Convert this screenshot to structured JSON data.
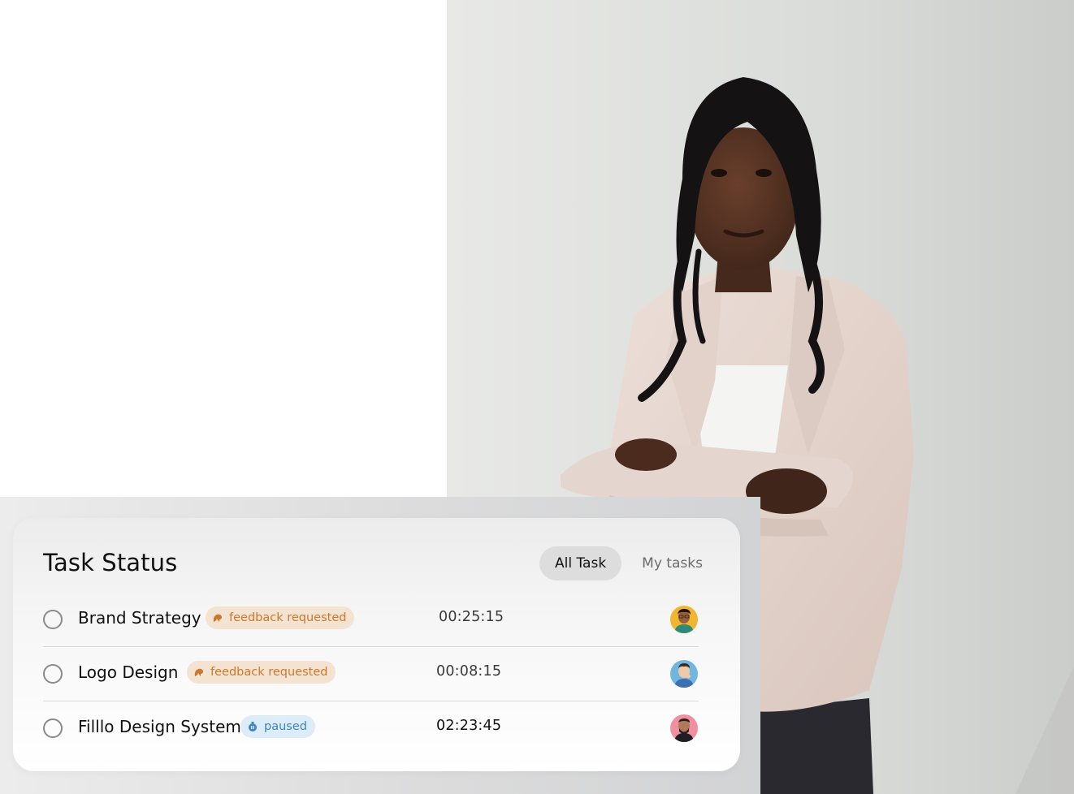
{
  "task_status": {
    "title": "Task Status",
    "tabs": [
      {
        "label": "All Task",
        "active": true
      },
      {
        "label": "My tasks",
        "active": false
      }
    ],
    "tasks": [
      {
        "name": "Brand Strategy",
        "status": "feedback requested",
        "status_kind": "feedback",
        "time": "00:25:15",
        "avatar": "man-avatar-yellow-bg"
      },
      {
        "name": "Logo Design",
        "status": "feedback requested",
        "status_kind": "feedback",
        "time": "00:08:15",
        "avatar": "man-avatar-blue-bg"
      },
      {
        "name": "Filllo Design System",
        "status": "paused",
        "status_kind": "paused",
        "time": "02:23:45",
        "avatar": "man-avatar-pink-bg"
      }
    ]
  },
  "colors": {
    "feedback_badge_bg": "#f5e3d2",
    "feedback_badge_text": "#c9782e",
    "paused_badge_bg": "#dcecf8",
    "paused_badge_text": "#3d84c4",
    "active_tab_bg": "#dddddd"
  }
}
